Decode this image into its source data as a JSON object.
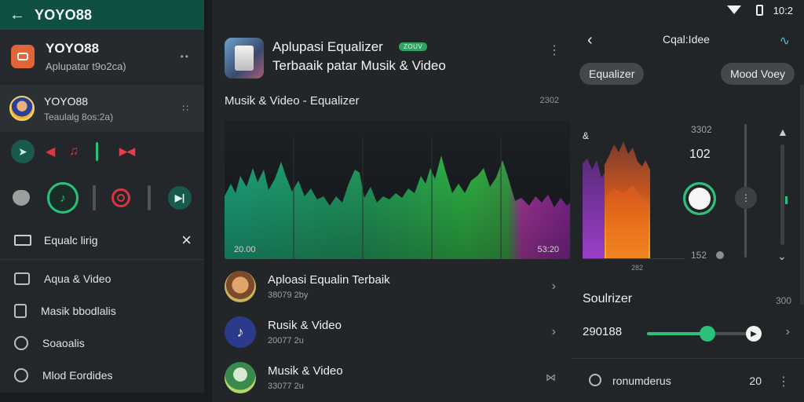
{
  "drawer": {
    "topbar_title": "YOYO88",
    "app": {
      "name": "YOYO88",
      "subtitle": "Aplupatar t9o2ca)"
    },
    "user": {
      "name": "YOYO88",
      "subtitle": "Teaulalg 8os:2a)"
    },
    "equalizer_row": "Equalc lirig",
    "menu": [
      {
        "label": "Aqua & Video",
        "icon": "video-icon"
      },
      {
        "label": "Masik bbodlalis",
        "icon": "music-icon"
      },
      {
        "label": "Soaoalis",
        "icon": "settings-icon"
      },
      {
        "label": "Mlod Eordides",
        "icon": "mode-icon"
      }
    ]
  },
  "main": {
    "title_line1": "Aplupasi Equalizer",
    "title_line2": "Terbaaik patar Musik & Video",
    "badge": "ZOUV",
    "section_label": "Musik & Video - Equalizer",
    "section_right": "2302",
    "viz_left_label": "20.00",
    "viz_right_label": "53:20",
    "list": [
      {
        "name": "Aploasi Equalin Terbaik",
        "sub": "38079 2by"
      },
      {
        "name": "Rusik & Video",
        "sub": "20077 2u"
      },
      {
        "name": "Musik & Video",
        "sub": "33077 2u"
      }
    ]
  },
  "panel": {
    "time": "10:2",
    "title": "Cqal:Idee",
    "chip_left": "Equalizer",
    "chip_right": "Mood Voey",
    "eq_tag": "&",
    "val_top": "3302",
    "val_mid": "102",
    "val_bot": "152",
    "eq_tick": "282",
    "sub_title": "Soulrizer",
    "sub_right": "300",
    "h_value": "290188",
    "h_level": 0.55,
    "foot_label": "ronumderus",
    "foot_num": "20"
  },
  "colors": {
    "accent_green": "#2ac27a",
    "topbar": "#0f4f44",
    "red_icon": "#e2343f"
  }
}
